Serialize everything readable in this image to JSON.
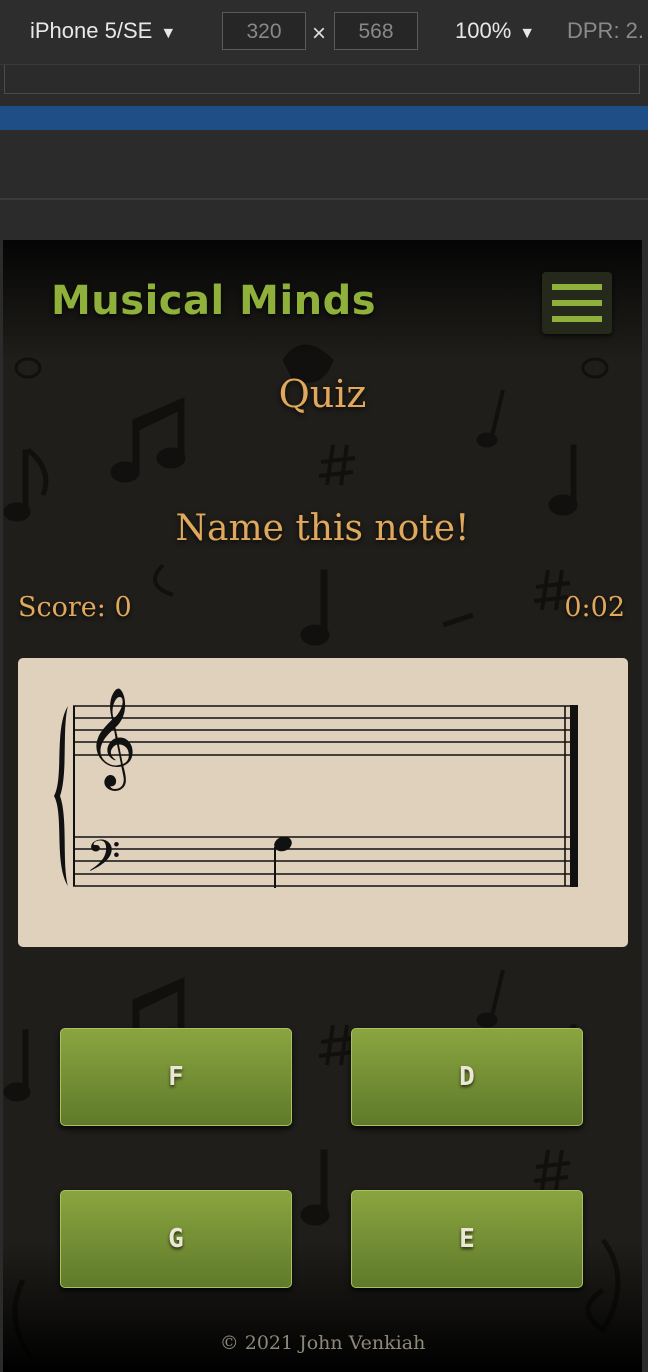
{
  "devtools": {
    "device": "iPhone 5/SE",
    "width": "320",
    "height": "568",
    "times": "×",
    "zoom": "100%",
    "dpr": "DPR: 2."
  },
  "app": {
    "brand": "Musical Minds",
    "page_title": "Quiz",
    "prompt": "Name this note!",
    "score_label": "Score: 0",
    "timer": "0:02",
    "answers": [
      "F",
      "D",
      "G",
      "E"
    ],
    "footer": "© 2021 John Venkiah"
  },
  "colors": {
    "brand": "#8fb03a",
    "heading": "#e0a85c",
    "button_top": "#8aa53f",
    "button_bottom": "#5f7a2b",
    "card": "#e0d1bd"
  },
  "icons": [
    "menu-icon",
    "treble-clef-icon",
    "bass-clef-icon",
    "quarter-note-icon",
    "caret-down-icon"
  ]
}
